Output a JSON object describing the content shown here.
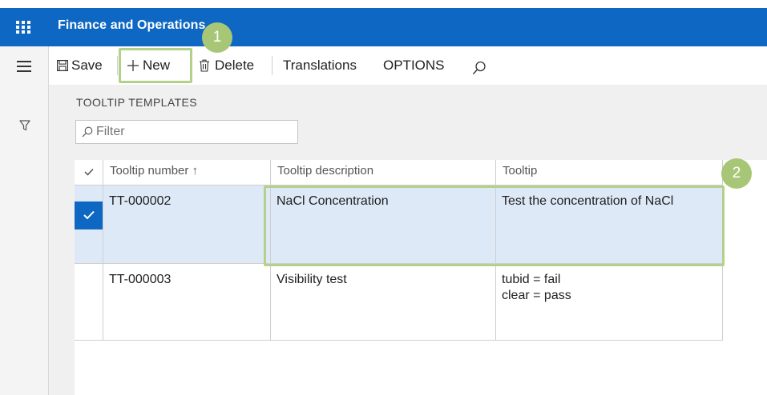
{
  "app": {
    "title": "Finance and Operations"
  },
  "toolbar": {
    "save_label": "Save",
    "new_label": "New",
    "delete_label": "Delete",
    "translations_label": "Translations",
    "options_label": "OPTIONS"
  },
  "page": {
    "section_title": "TOOLTIP TEMPLATES",
    "filter_placeholder": "Filter"
  },
  "grid": {
    "columns": [
      "Tooltip number ↑",
      "Tooltip description",
      "Tooltip"
    ],
    "rows": [
      {
        "number": "TT-000002",
        "description": "NaCl Concentration",
        "tooltip": "Test the concentration of NaCl",
        "selected": true
      },
      {
        "number": "TT-000003",
        "description": "Visibility test",
        "tooltip": "tubid = fail\nclear = pass",
        "selected": false
      }
    ]
  },
  "callouts": {
    "first": "1",
    "second": "2"
  },
  "colors": {
    "brand": "#0e68c3",
    "callout": "#a8c776",
    "selected_row": "#dde9f7"
  }
}
